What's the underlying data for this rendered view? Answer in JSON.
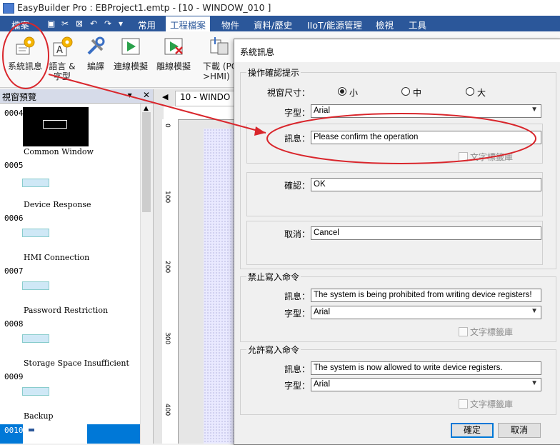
{
  "app": {
    "title": "EasyBuilder Pro : EBProject1.emtp - [10 - WINDOW_010 ]"
  },
  "menubar": {
    "file_tab": "檔案",
    "tabs": [
      "常用",
      "工程檔案",
      "物件",
      "資料/歷史",
      "IIoT/能源管理",
      "檢視",
      "工具"
    ],
    "active_tab": "工程檔案"
  },
  "ribbon": {
    "buttons": [
      {
        "label": "系統訊息",
        "icon": "system-message-icon"
      },
      {
        "label": "語言 & 字型",
        "icon": "language-font-icon"
      },
      {
        "label": "編譯",
        "icon": "compile-icon"
      },
      {
        "label": "連線模擬",
        "icon": "online-simulation-icon"
      },
      {
        "label": "離線模擬",
        "icon": "offline-simulation-icon"
      },
      {
        "label": "下載 (PC->HMI)",
        "icon": "download-icon"
      }
    ]
  },
  "window_tree": {
    "title": "視窗預覽",
    "pin": "▾",
    "close": "✕",
    "items": [
      {
        "num": "0004",
        "name": "Common Window"
      },
      {
        "num": "0005",
        "name": "Device Response"
      },
      {
        "num": "0006",
        "name": "HMI Connection"
      },
      {
        "num": "0007",
        "name": "Password Restriction"
      },
      {
        "num": "0008",
        "name": "Storage Space Insufficient"
      },
      {
        "num": "0009",
        "name": "Backup"
      },
      {
        "num": "0010",
        "name": ""
      }
    ]
  },
  "editor": {
    "tab_label": "10 - WINDO",
    "ruler_marks": [
      "0",
      "100",
      "200",
      "300",
      "400"
    ]
  },
  "dialog": {
    "title": "系統訊息",
    "confirm_group": {
      "legend": "操作確認提示",
      "window_size_label": "視窗尺寸：",
      "size_options": [
        "小",
        "中",
        "大"
      ],
      "selected_size": "小",
      "font_label": "字型：",
      "font_value": "Arial",
      "message_label": "訊息：",
      "message_value": "Please confirm the operation",
      "label_library": "文字標籤庫",
      "ok_label": "確認：",
      "ok_value": "OK",
      "cancel_label": "取消：",
      "cancel_value": "Cancel"
    },
    "prohibit_group": {
      "legend": "禁止寫入命令",
      "message_label": "訊息：",
      "message_value": "The system is being prohibited from writing device registers!",
      "font_label": "字型：",
      "font_value": "Arial",
      "label_library": "文字標籤庫"
    },
    "allow_group": {
      "legend": "允許寫入命令",
      "message_label": "訊息：",
      "message_value": "The system is now allowed to write device registers.",
      "font_label": "字型：",
      "font_value": "Arial",
      "label_library": "文字標籤庫"
    },
    "buttons": {
      "ok": "確定",
      "cancel": "取消"
    }
  },
  "colors": {
    "menubar": "#2b579a",
    "annotation": "#d9262c",
    "selection": "#0078d7"
  }
}
